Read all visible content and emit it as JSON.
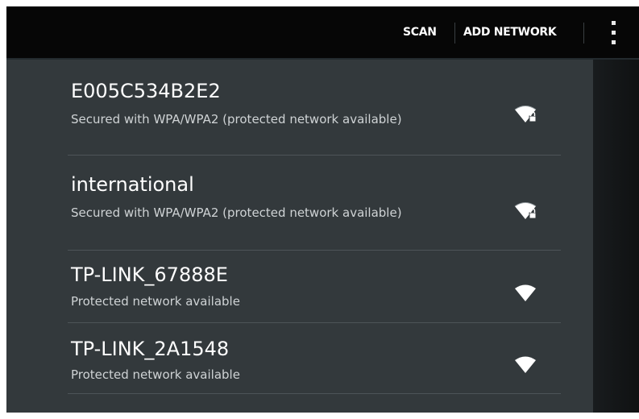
{
  "actionbar": {
    "scan_label": "SCAN",
    "add_network_label": "ADD NETWORK"
  },
  "networks": [
    {
      "ssid": "E005C534B2E2",
      "summary": "Secured with WPA/WPA2 (protected network available)",
      "signal_icon": "wifi-locked-icon"
    },
    {
      "ssid": "international",
      "summary": "Secured with WPA/WPA2 (protected network available)",
      "signal_icon": "wifi-locked-icon"
    },
    {
      "ssid": "TP-LINK_67888E",
      "summary": "Protected network available",
      "signal_icon": "wifi-icon"
    },
    {
      "ssid": "TP-LINK_2A1548",
      "summary": "Protected network available",
      "signal_icon": "wifi-icon"
    }
  ],
  "colors": {
    "actionbar": "#060606",
    "list_background": "#33393c",
    "text_primary": "#ffffff",
    "text_secondary": "#cfd3d5"
  }
}
